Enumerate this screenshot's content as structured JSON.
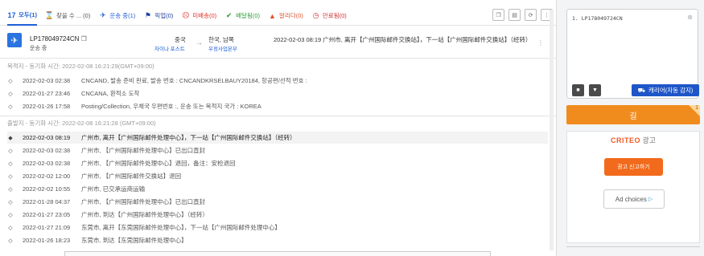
{
  "tabs": [
    {
      "label": "모두(1)",
      "icon": "all-icon"
    },
    {
      "label": "찾을 수 ... (0)",
      "icon": "hourglass-icon"
    },
    {
      "label": "운송 중(1)",
      "icon": "airplane-icon"
    },
    {
      "label": "픽업(0)",
      "icon": "flag-icon"
    },
    {
      "label": "미배송(0)",
      "icon": "sad-face-icon"
    },
    {
      "label": "배달됨(0)",
      "icon": "check-icon"
    },
    {
      "label": "알리다(0)",
      "icon": "warning-icon"
    },
    {
      "label": "만료됨(0)",
      "icon": "clock-icon"
    }
  ],
  "colors": {
    "accent": "#1d5fd6",
    "delivered": "#2e9e3a",
    "alert": "#e0502b",
    "undelivered": "#e0302b",
    "orange": "#f08c1e"
  },
  "package": {
    "id": "LP178049724CN",
    "status": "운송 중",
    "origin_country": "중국",
    "origin_carrier": "차이나 포스트",
    "dest_country": "한국, 남쪽",
    "dest_carrier": "우정사업본부",
    "latest": "2022-02-03 08:19 广州市, 离开【广州国际邮件交换站】，下一站【广州国际邮件交换站】（经转）"
  },
  "destination": {
    "header": "목적지 - 동기화 시간: 2022-02-08 16:21:29(GMT+09:00)",
    "events": [
      {
        "time": "2022-02-03 02:38",
        "text": "CNCAND, 발송 준비 완료, 발송 번호 : CNCANDKRSELBAUY20184, 항공편/선적 번호 :"
      },
      {
        "time": "2022-01-27 23:46",
        "text": "CNCANA, 환적소 도착"
      },
      {
        "time": "2022-01-26 17:58",
        "text": "Posting/Collection, 우체국 우편번호 :, 운송 또는 목적지 국가 : KOREA"
      }
    ]
  },
  "origin": {
    "header": "출발지 - 동기화 시간: 2022-02-08 16:21:28 (GMT+09:00)",
    "events": [
      {
        "time": "2022-02-03 08:19",
        "text": "广州市, 离开【广州国际邮件处理中心】，下一站【广州国际邮件交换站】（经转）"
      },
      {
        "time": "2022-02-03 02:38",
        "text": "广州市, 【广州国际邮件处理中心】已出口直封"
      },
      {
        "time": "2022-02-03 02:38",
        "text": "广州市, 【广州国际邮件处理中心】退回，备注：安检退回"
      },
      {
        "time": "2022-02-02 12:00",
        "text": "广州市, 【广州国际邮件交换站】退回"
      },
      {
        "time": "2022-02-02 10:55",
        "text": "广州市, 已交承运商运输"
      },
      {
        "time": "2022-01-28 04:37",
        "text": "广州市, 【广州国际邮件处理中心】已出口直封"
      },
      {
        "time": "2022-01-27 23:05",
        "text": "广州市, 到达【广州国际邮件处理中心】（经转）"
      },
      {
        "time": "2022-01-27 21:09",
        "text": "东莞市, 离开【东莞国际邮件处理中心】，下一站【广州国际邮件处理中心】"
      },
      {
        "time": "2022-01-26 18:23",
        "text": "东莞市, 到达【东莞国际邮件处理中心】"
      }
    ]
  },
  "sidebar": {
    "input_value": "1. LP178049724CN",
    "carrier_label": "캐리어(자동 감지)",
    "go_label": "길",
    "go_badge": "1",
    "ad_brand": "CRITEO",
    "ad_label": "광고",
    "ad_report": "광고 신고하기",
    "ad_choices": "Ad choices"
  }
}
